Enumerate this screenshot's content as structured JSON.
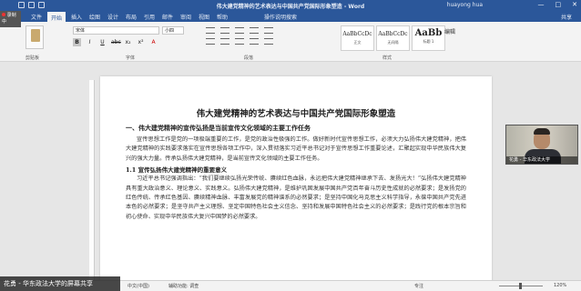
{
  "window": {
    "title": "伟大建党精神的艺术表达与中国共产党国际形象塑造 - Word",
    "user": "huayong hua",
    "controls": [
      "—",
      "□",
      "✕"
    ]
  },
  "tabs": [
    {
      "label": "文件",
      "active": false
    },
    {
      "label": "开始",
      "active": true
    },
    {
      "label": "插入",
      "active": false
    },
    {
      "label": "绘图",
      "active": false
    },
    {
      "label": "设计",
      "active": false
    },
    {
      "label": "布局",
      "active": false
    },
    {
      "label": "引用",
      "active": false
    },
    {
      "label": "邮件",
      "active": false
    },
    {
      "label": "审阅",
      "active": false
    },
    {
      "label": "视图",
      "active": false
    },
    {
      "label": "帮助",
      "active": false
    }
  ],
  "tell_me": "操作说明搜索",
  "share_label": "共享",
  "ribbon": {
    "font_name": "宋体",
    "font_size": "小四",
    "format_buttons": [
      "B",
      "I",
      "U",
      "abc",
      "x₂",
      "x²",
      "A"
    ],
    "styles": [
      {
        "preview": "AaBbCcDc",
        "name": "正文"
      },
      {
        "preview": "AaBbCcDc",
        "name": "无间隔"
      },
      {
        "preview": "AaBb",
        "name": "标题 1"
      }
    ],
    "edit_label": "编辑",
    "group_labels": [
      "剪贴板",
      "字体",
      "段落",
      "样式"
    ]
  },
  "document": {
    "title": "伟大建党精神的艺术表达与中国共产党国际形象塑造",
    "heading1": "一、伟大建党精神的宣传弘扬是当前宣传文化领域的主要工作任务",
    "para1": "宣传思想工作是党的一项极端重要的工作，是党的政治性极强的工作。做好新时代宣传思想工作，必须大力弘扬伟大建党精神，把伟大建党精神的实践要求落实在宣传思想各项工作中，深入贯彻落实习近平总书记对于宣传思想工作重要论述，汇聚起实现中华民族伟大复兴的强大力量。传承弘扬伟大建党精神，是当前宣传文化领域的主要工作任务。",
    "heading2": "1.1 宣传弘扬伟大建党精神的重要意义",
    "para2": "习近平总书记强调指出：“我们要继续弘扬光荣传统、赓续红色血脉，永远把伟大建党精神继承下去、发扬光大！”弘扬伟大建党精神具有重大政治意义、理论意义、实践意义。弘扬伟大建党精神，是维护巩固发展中国共产党百年奋斗历史性成就的必然要求；是发扬党的红色传统、传承红色基因、赓续精神血脉、丰富发展党的精神谱系的必然要求；是坚持中国化马克思主义科学指导，永葆中国共产党先进本色的必然要求；是坚守共产主义理想、坚定中国特色社会主义信念、坚持和发展中国特色社会主义的必然要求；是践行党的根本宗旨和初心使命、实现中华民族伟大复兴中国梦的必然要求。"
  },
  "statusbar": {
    "page": "第 1 页，共 1 页",
    "words": "1326 个字",
    "language": "中文(中国)",
    "accessibility": "辅助功能: 调查",
    "focus": "专注",
    "zoom": "120%"
  },
  "overlays": {
    "recording": "录制中",
    "share_banner": "花勇 - 华东政法大学的屏幕共享",
    "webcam_label": "花勇 - 华东政法大学"
  },
  "colors": {
    "word_blue": "#2b579a",
    "ribbon_bg": "#f3f3f3",
    "page_bg": "#ffffff",
    "canvas_bg": "#e6e6e6"
  }
}
